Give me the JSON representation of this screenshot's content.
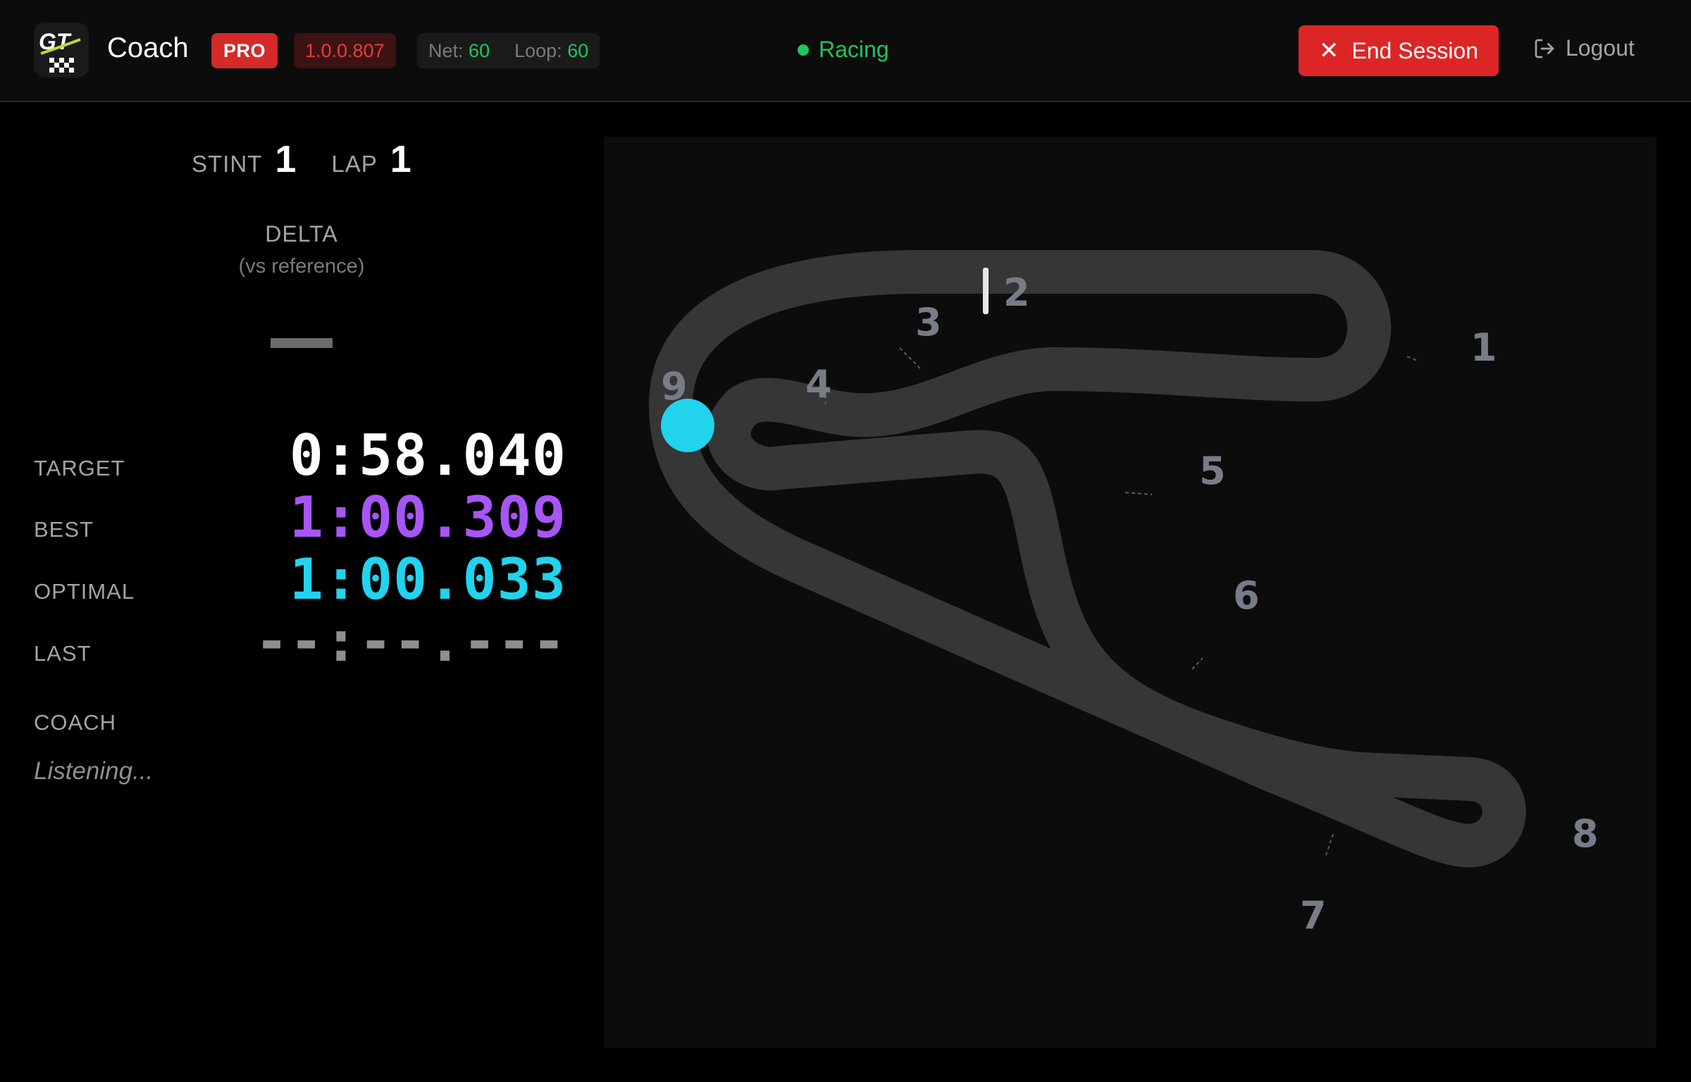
{
  "header": {
    "app_name": "Coach",
    "logo_text": "GT",
    "plan_badge": "PRO",
    "version": "1.0.0.807",
    "net_label": "Net:",
    "net_value": "60",
    "loop_label": "Loop:",
    "loop_value": "60",
    "status": "Racing",
    "end_session_label": "End Session",
    "logout_label": "Logout"
  },
  "session": {
    "stint_label": "STINT",
    "stint_value": "1",
    "lap_label": "LAP",
    "lap_value": "1",
    "delta_title": "DELTA",
    "delta_subtitle": "(vs reference)",
    "delta_value": "—"
  },
  "times": [
    {
      "label": "TARGET",
      "value": "0:58.040",
      "color": "#ffffff"
    },
    {
      "label": "BEST",
      "value": "1:00.309",
      "color": "#a855f7"
    },
    {
      "label": "OPTIMAL",
      "value": "1:00.033",
      "color": "#22d3ee"
    },
    {
      "label": "LAST",
      "value": "--:--.---",
      "color": "#8f8f8f"
    }
  ],
  "coach": {
    "label": "COACH",
    "message": "Listening..."
  },
  "track": {
    "turns": [
      "1",
      "2",
      "3",
      "4",
      "5",
      "6",
      "7",
      "8",
      "9"
    ],
    "track_color": "#363636",
    "car_color": "#22d3ee",
    "turn_label_color": "#777c88"
  },
  "colors": {
    "accent_red": "#dc2626",
    "status_green": "#22c55e",
    "best_purple": "#a855f7",
    "optimal_cyan": "#22d3ee"
  }
}
